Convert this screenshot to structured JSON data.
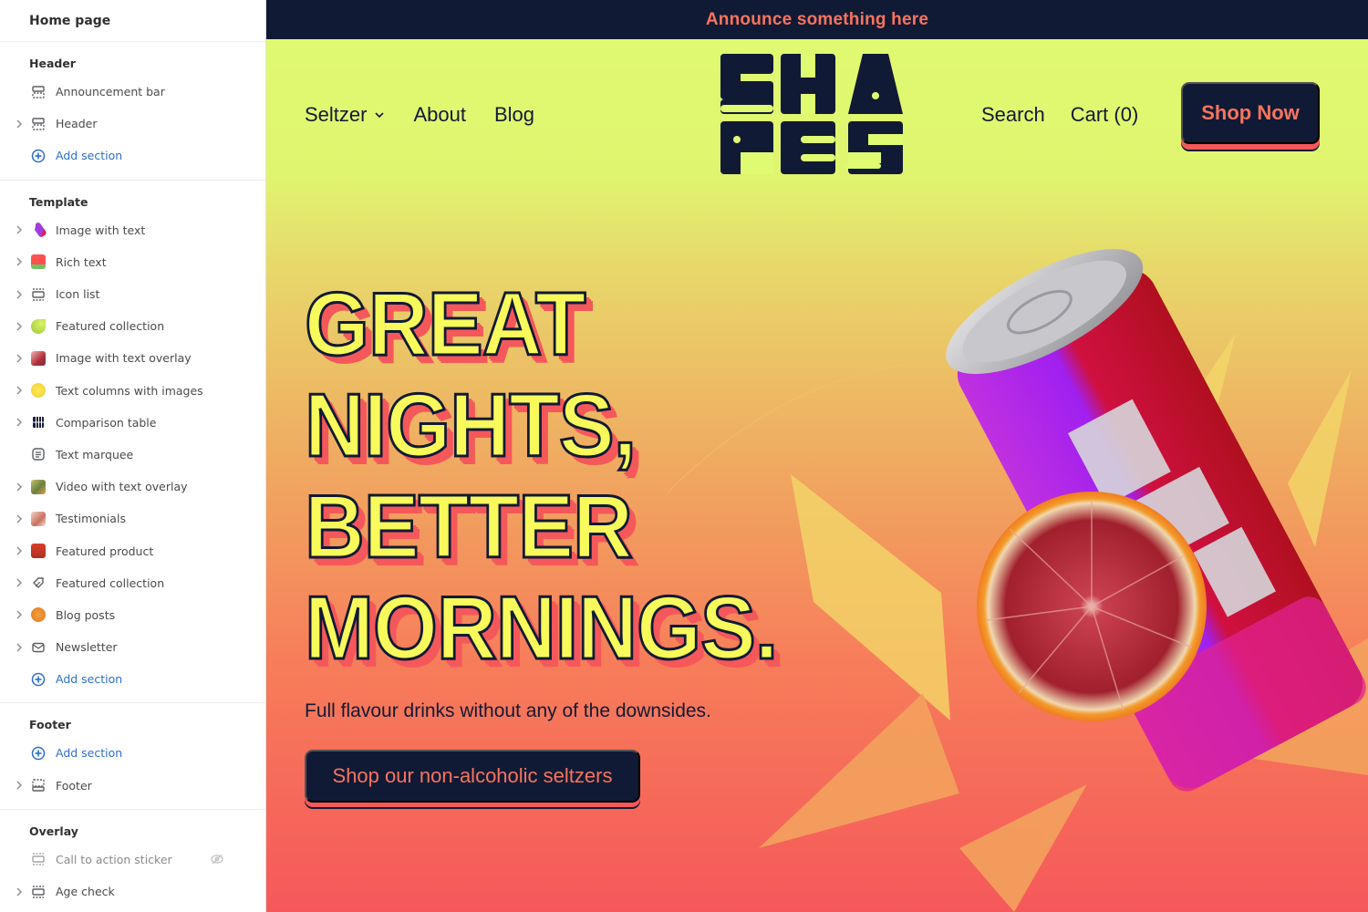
{
  "sidebar": {
    "title": "Home page",
    "groups": [
      {
        "title": "Header",
        "items": [
          {
            "label": "Announcement bar",
            "icon": "section-icon",
            "expandable": false
          },
          {
            "label": "Header",
            "icon": "section-icon",
            "expandable": true
          },
          {
            "label": "Add section",
            "icon": "plus-circle-icon",
            "add": true
          }
        ]
      },
      {
        "title": "Template",
        "items": [
          {
            "label": "Image with text",
            "icon": "can-thumbnail",
            "expandable": true
          },
          {
            "label": "Rich text",
            "icon": "watermelon-thumbnail",
            "expandable": true
          },
          {
            "label": "Icon list",
            "icon": "list-section-icon",
            "expandable": true
          },
          {
            "label": "Featured collection",
            "icon": "lime-thumbnail",
            "expandable": true
          },
          {
            "label": "Image with text overlay",
            "icon": "photo-thumbnail",
            "expandable": true
          },
          {
            "label": "Text columns with images",
            "icon": "lemon-thumbnail",
            "expandable": true
          },
          {
            "label": "Comparison table",
            "icon": "table-icon",
            "expandable": true
          },
          {
            "label": "Text marquee",
            "icon": "text-icon",
            "expandable": false
          },
          {
            "label": "Video with text overlay",
            "icon": "video-thumbnail",
            "expandable": true
          },
          {
            "label": "Testimonials",
            "icon": "people-thumbnail",
            "expandable": true
          },
          {
            "label": "Featured product",
            "icon": "product-thumbnail",
            "expandable": true
          },
          {
            "label": "Featured collection",
            "icon": "tag-icon",
            "expandable": true
          },
          {
            "label": "Blog posts",
            "icon": "orange-thumbnail",
            "expandable": true
          },
          {
            "label": "Newsletter",
            "icon": "mail-icon",
            "expandable": true
          },
          {
            "label": "Add section",
            "icon": "plus-circle-icon",
            "add": true
          }
        ]
      },
      {
        "title": "Footer",
        "items": [
          {
            "label": "Add section",
            "icon": "plus-circle-icon",
            "add": true
          },
          {
            "label": "Footer",
            "icon": "footer-icon",
            "expandable": true
          }
        ]
      },
      {
        "title": "Overlay",
        "items": [
          {
            "label": "Call to action sticker",
            "icon": "list-section-icon",
            "expandable": false,
            "hidden": true
          },
          {
            "label": "Age check",
            "icon": "list-section-icon",
            "expandable": true
          }
        ]
      }
    ]
  },
  "preview": {
    "announcement": "Announce something here",
    "nav_left": [
      {
        "label": "Seltzer",
        "dropdown": true
      },
      {
        "label": "About"
      },
      {
        "label": "Blog"
      }
    ],
    "logo_text": "SHAPES",
    "nav_right": [
      {
        "label": "Search"
      },
      {
        "label": "Cart (0)"
      }
    ],
    "shop_now": "Shop Now",
    "headline": [
      "GREAT",
      "NIGHTS,",
      "BETTER",
      "MORNINGS."
    ],
    "subtitle": "Full flavour drinks without any of the downsides.",
    "cta": "Shop our non-alcoholic seltzers"
  },
  "colors": {
    "navy": "#111a35",
    "coral": "#f7745d",
    "red": "#f5585a",
    "lime": "#dffb72",
    "headline_yellow": "#f7fa5a",
    "link_blue": "#2c6ecb"
  }
}
